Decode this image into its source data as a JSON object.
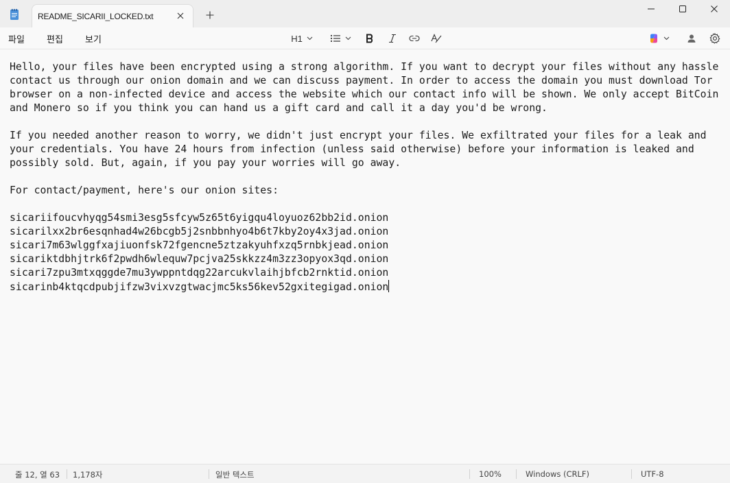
{
  "tab": {
    "title": "README_SICARII_LOCKED.txt"
  },
  "menu": {
    "file": "파일",
    "edit": "편집",
    "view": "보기"
  },
  "toolbar": {
    "heading": "H1"
  },
  "editor": {
    "lines": [
      "Hello, your files have been encrypted using a strong algorithm. If you want to decrypt your files without any hassle",
      "contact us through our onion domain and we can discuss payment. In order to access the domain you must download Tor",
      "browser on a non-infected device and access the website which our contact info will be shown. We only accept BitCoin",
      "and Monero so if you think you can hand us a gift card and call it a day you'd be wrong.",
      "",
      "If you needed another reason to worry, we didn't just encrypt your files. We exfiltrated your files for a leak and",
      "your credentials. You have 24 hours from infection (unless said otherwise) before your information is leaked and",
      "possibly sold. But, again, if you pay your worries will go away.",
      "",
      "For contact/payment, here's our onion sites:",
      "",
      "sicariifoucvhyqg54smi3esg5sfcyw5z65t6yigqu4loyuoz62bb2id.onion",
      "sicarilxx2br6esqnhad4w26bcgb5j2snbbnhyo4b6t7kby2oy4x3jad.onion",
      "sicari7m63wlggfxajiuonfsk72fgencne5ztzakyuhfxzq5rnbkjead.onion",
      "sicariktdbhjtrk6f2pwdh6wlequw7pcjva25skkzz4m3zz3opyox3qd.onion",
      "sicari7zpu3mtxqggde7mu3ywppntdqg22arcukvlaihjbfcb2rnktid.onion",
      "sicarinb4ktqcdpubjifzw3vixvzgtwacjmc5ks56kev52gxitegigad.onion"
    ]
  },
  "status": {
    "position": "줄 12, 열 63",
    "chars": "1,178자",
    "format": "일반 텍스트",
    "zoom": "100%",
    "line_ending": "Windows (CRLF)",
    "encoding": "UTF-8"
  },
  "colors": {
    "accent": "#0067c0"
  },
  "icons": {
    "app": "notepad-icon",
    "close_tab": "close-icon",
    "new_tab": "plus-icon",
    "minimize": "minimize-icon",
    "maximize": "maximize-icon",
    "close_window": "close-icon",
    "list": "list-icon",
    "bold": "bold-icon",
    "italic": "italic-icon",
    "link": "link-icon",
    "clear_format": "clear-formatting-icon",
    "copilot": "copilot-icon",
    "account": "account-icon",
    "settings": "gear-icon"
  }
}
